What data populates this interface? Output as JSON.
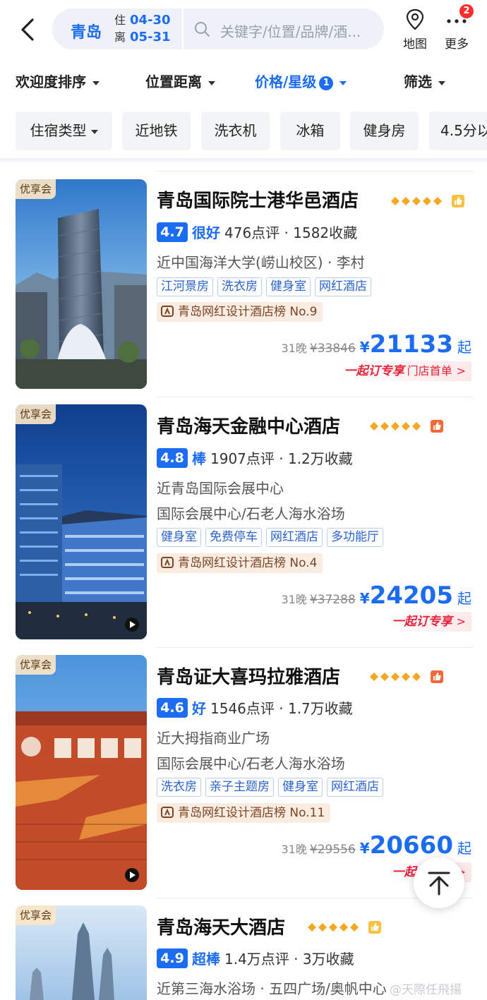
{
  "header": {
    "city": "青岛",
    "checkin_label": "住",
    "checkin_date": "04-30",
    "checkout_label": "离",
    "checkout_date": "05-31",
    "search_placeholder": "关键字/位置/品牌/酒...",
    "map_label": "地图",
    "more_label": "更多",
    "more_badge": "2"
  },
  "sort_bar": {
    "items": [
      {
        "label": "欢迎度排序"
      },
      {
        "label": "位置距离"
      },
      {
        "label": "价格/星级",
        "badge": "1"
      },
      {
        "label": "筛选"
      }
    ]
  },
  "filter_chips": [
    "住宿类型",
    "近地铁",
    "洗衣机",
    "冰箱",
    "健身房",
    "4.5分以"
  ],
  "hotels": [
    {
      "vip_tag": "优享会",
      "name": "青岛国际院士港华邑酒店",
      "score": "4.7",
      "score_word": "很好",
      "reviews": "476点评 · 1582收藏",
      "location_lines": [
        "近中国海洋大学(崂山校区) · 李村"
      ],
      "tags": [
        "江河景房",
        "洗衣房",
        "健身室",
        "网红酒店"
      ],
      "rank": "青岛网红设计酒店榜 No.9",
      "nights": "31晚",
      "original_price": "¥33846",
      "currency": "¥",
      "price": "21133",
      "price_suffix": "起",
      "promo": "一起订专享",
      "promo_extra": "门店首单",
      "has_video": false
    },
    {
      "vip_tag": "优享会",
      "name": "青岛海天金融中心酒店",
      "score": "4.8",
      "score_word": "棒",
      "reviews": "1907点评 · 1.2万收藏",
      "location_lines": [
        "近青岛国际会展中心",
        "国际会展中心/石老人海水浴场"
      ],
      "tags": [
        "健身室",
        "免费停车",
        "网红酒店",
        "多功能厅"
      ],
      "rank": "青岛网红设计酒店榜 No.4",
      "nights": "31晚",
      "original_price": "¥37288",
      "currency": "¥",
      "price": "24205",
      "price_suffix": "起",
      "promo": "一起订专享",
      "promo_extra": "",
      "has_video": true
    },
    {
      "vip_tag": "优享会",
      "name": "青岛证大喜玛拉雅酒店",
      "score": "4.6",
      "score_word": "好",
      "reviews": "1546点评 · 1.7万收藏",
      "location_lines": [
        "近大拇指商业广场",
        "国际会展中心/石老人海水浴场"
      ],
      "tags": [
        "洗衣房",
        "亲子主题房",
        "健身室",
        "网红酒店"
      ],
      "rank": "青岛网红设计酒店榜 No.11",
      "nights": "31晚",
      "original_price": "¥29556",
      "currency": "¥",
      "price": "20660",
      "price_suffix": "起",
      "promo": "一起订专享",
      "promo_extra": "",
      "has_video": true
    },
    {
      "vip_tag": "优享会",
      "name": "青岛海天大酒店",
      "score": "4.9",
      "score_word": "超棒",
      "reviews": "1.4万点评 · 3万收藏",
      "location_lines": [
        "近第三海水浴场 · 五四广场/奥帆中心"
      ],
      "tags": [],
      "rank": "",
      "has_video": false
    }
  ],
  "watermark": "@天際任飛揚",
  "colors": {
    "accent_blue": "#1c6cf2",
    "promo_red": "#e8213a",
    "star_gold": "#f5a623",
    "badge_red": "#ff2d2d"
  }
}
